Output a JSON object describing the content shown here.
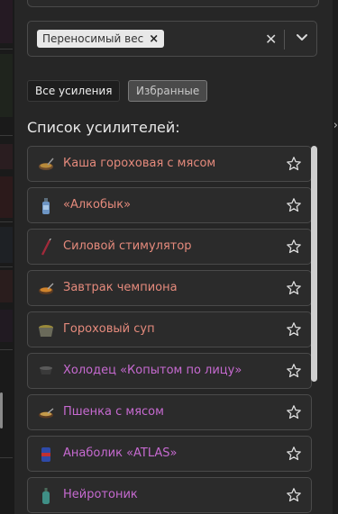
{
  "select": {
    "selected_tag": "Переносимый вес",
    "tag_remove_symbol": "×",
    "clear_symbol": "✕"
  },
  "filters": {
    "all_label": "Все усиления",
    "favorites_label": "Избранные"
  },
  "list": {
    "title": "Список усилителей:",
    "items": [
      {
        "label": "Каша гороховая с мясом",
        "color": "#e58a7c",
        "icon": "pea-porridge-bowl-icon"
      },
      {
        "label": "«Алкобык»",
        "color": "#e58a7c",
        "icon": "energy-drink-bottle-icon"
      },
      {
        "label": "Силовой стимулятор",
        "color": "#e58a7c",
        "icon": "syringe-stimulator-icon"
      },
      {
        "label": "Завтрак чемпиона",
        "color": "#e58a7c",
        "icon": "breakfast-bowl-icon"
      },
      {
        "label": "Гороховый суп",
        "color": "#e58a7c",
        "icon": "pea-soup-pot-icon"
      },
      {
        "label": "Холодец «Копытом по лицу»",
        "color": "#c66ad0",
        "icon": "aspic-dish-icon"
      },
      {
        "label": "Пшенка с мясом",
        "color": "#c66ad0",
        "icon": "millet-porridge-bowl-icon"
      },
      {
        "label": "Анаболик «ATLAS»",
        "color": "#c66ad0",
        "icon": "anabolic-can-icon"
      },
      {
        "label": "Нейротоник",
        "color": "#c66ad0",
        "icon": "neurotonic-bottle-icon"
      }
    ]
  },
  "right_edge_symbol": "›"
}
